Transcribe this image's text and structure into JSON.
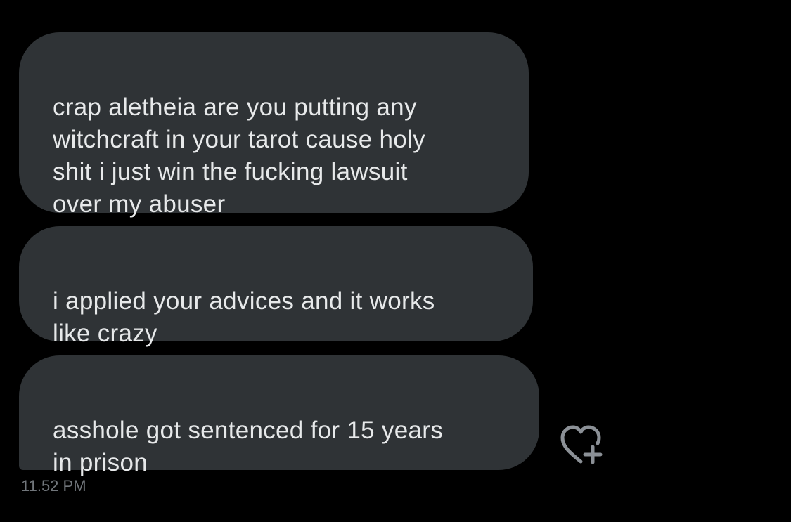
{
  "messages": [
    {
      "text": "crap aletheia are you putting any\nwitchcraft in your tarot cause holy\nshit i just win the fucking lawsuit\nover my abuser"
    },
    {
      "text": "i applied your advices and it works\nlike crazy"
    },
    {
      "text": "asshole got sentenced for 15 years\nin prison"
    }
  ],
  "timestamp": "11.52 PM",
  "reaction_button": {
    "icon": "heart-plus-icon"
  },
  "colors": {
    "background": "#000000",
    "bubble": "#2f3336",
    "text": "#e7e9ea",
    "meta": "#71767b",
    "icon": "#8b9096"
  }
}
